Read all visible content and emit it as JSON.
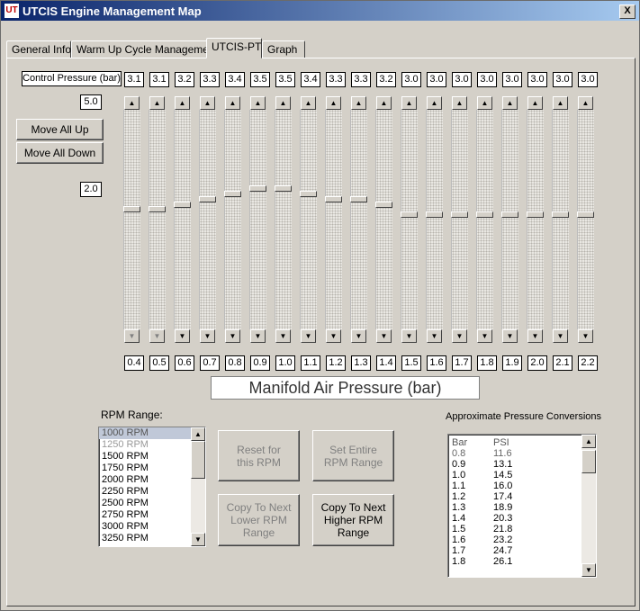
{
  "window": {
    "title": "UTCIS Engine Management Map",
    "icon_text": "UT",
    "close_label": "X"
  },
  "tabs": [
    {
      "label": "General Info",
      "active": false
    },
    {
      "label": "Warm Up Cycle Management",
      "active": false
    },
    {
      "label": "UTCIS-PT",
      "active": true
    },
    {
      "label": "Graph",
      "active": false
    }
  ],
  "control_pressure_label": "Control Pressure (bar)",
  "scale": {
    "max_label": "5.0",
    "min_label": "2.0",
    "max_value": 5.0,
    "min_value": 2.0
  },
  "buttons": {
    "move_all_up": "Move All Up",
    "move_all_down": "Move All Down",
    "reset_rpm": "Reset for this RPM",
    "set_entire": "Set Entire RPM Range",
    "copy_lower": "Copy To Next Lower RPM Range",
    "copy_higher": "Copy To Next Higher RPM Range"
  },
  "map_axis_label": "Manifold Air Pressure (bar)",
  "sliders": [
    {
      "map": "0.4",
      "pressure": "3.1",
      "value": 3.1
    },
    {
      "map": "0.5",
      "pressure": "3.1",
      "value": 3.1
    },
    {
      "map": "0.6",
      "pressure": "3.2",
      "value": 3.2
    },
    {
      "map": "0.7",
      "pressure": "3.3",
      "value": 3.3
    },
    {
      "map": "0.8",
      "pressure": "3.4",
      "value": 3.4
    },
    {
      "map": "0.9",
      "pressure": "3.5",
      "value": 3.5
    },
    {
      "map": "1.0",
      "pressure": "3.5",
      "value": 3.5
    },
    {
      "map": "1.1",
      "pressure": "3.4",
      "value": 3.4
    },
    {
      "map": "1.2",
      "pressure": "3.3",
      "value": 3.3
    },
    {
      "map": "1.3",
      "pressure": "3.3",
      "value": 3.3
    },
    {
      "map": "1.4",
      "pressure": "3.2",
      "value": 3.2
    },
    {
      "map": "1.5",
      "pressure": "3.0",
      "value": 3.0
    },
    {
      "map": "1.6",
      "pressure": "3.0",
      "value": 3.0
    },
    {
      "map": "1.7",
      "pressure": "3.0",
      "value": 3.0
    },
    {
      "map": "1.8",
      "pressure": "3.0",
      "value": 3.0
    },
    {
      "map": "1.9",
      "pressure": "3.0",
      "value": 3.0
    },
    {
      "map": "2.0",
      "pressure": "3.0",
      "value": 3.0
    },
    {
      "map": "2.1",
      "pressure": "3.0",
      "value": 3.0
    },
    {
      "map": "2.2",
      "pressure": "3.0",
      "value": 3.0
    }
  ],
  "rpm": {
    "label": "RPM Range:",
    "items": [
      "1000 RPM",
      "1250 RPM",
      "1500 RPM",
      "1750 RPM",
      "2000 RPM",
      "2250 RPM",
      "2500 RPM",
      "2750 RPM",
      "3000 RPM",
      "3250 RPM"
    ],
    "selected_index": 0
  },
  "conversions": {
    "label": "Approximate Pressure Conversions",
    "header": {
      "bar": "Bar",
      "psi": "PSI"
    },
    "rows": [
      {
        "bar": "0.8",
        "psi": "11.6"
      },
      {
        "bar": "0.9",
        "psi": "13.1"
      },
      {
        "bar": "1.0",
        "psi": "14.5"
      },
      {
        "bar": "1.1",
        "psi": "16.0"
      },
      {
        "bar": "1.2",
        "psi": "17.4"
      },
      {
        "bar": "1.3",
        "psi": "18.9"
      },
      {
        "bar": "1.4",
        "psi": "20.3"
      },
      {
        "bar": "1.5",
        "psi": "21.8"
      },
      {
        "bar": "1.6",
        "psi": "23.2"
      },
      {
        "bar": "1.7",
        "psi": "24.7"
      },
      {
        "bar": "1.8",
        "psi": "26.1"
      }
    ]
  },
  "colors": {
    "face": "#d4d0c8",
    "title_start": "#0a246a",
    "title_end": "#a6caf0"
  }
}
